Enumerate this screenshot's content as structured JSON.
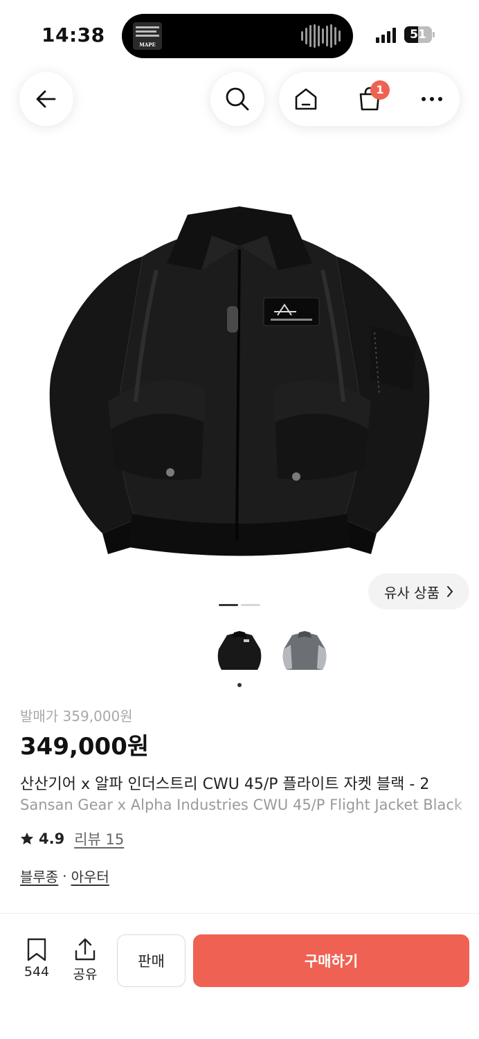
{
  "status_bar": {
    "time": "14:38",
    "now_playing_art_label": "MAPE",
    "battery_level": "51",
    "battery_fraction": 0.51
  },
  "nav": {
    "back_icon": "arrow-left-icon",
    "search_icon": "search-icon",
    "home_icon": "home-icon",
    "cart_icon": "shopping-bag-icon",
    "cart_badge": "1",
    "more_icon": "more-horizontal-icon"
  },
  "gallery": {
    "similar_products_label": "유사 상품",
    "slide_count": 2,
    "active_slide": 1,
    "thumbnail_count": 2,
    "active_thumbnail": 1
  },
  "product": {
    "release_price_label": "발매가 359,000원",
    "price": "349,000원",
    "title_ko": "산산기어 x 알파 인더스트리 CWU 45/P 플라이트 자켓 블랙 - 2",
    "title_en": "Sansan Gear x Alpha Industries CWU 45/P Flight Jacket Black",
    "rating": "4.9",
    "review_label": "리뷰 15",
    "category_1": "블루종",
    "category_sep": "·",
    "category_2": "아우터"
  },
  "bottom_bar": {
    "bookmark_count": "544",
    "share_label": "공유",
    "sell_label": "판매",
    "buy_label": "구매하기"
  },
  "colors": {
    "accent": "#ef6253",
    "text": "#222222",
    "muted": "#a8a8a8"
  }
}
